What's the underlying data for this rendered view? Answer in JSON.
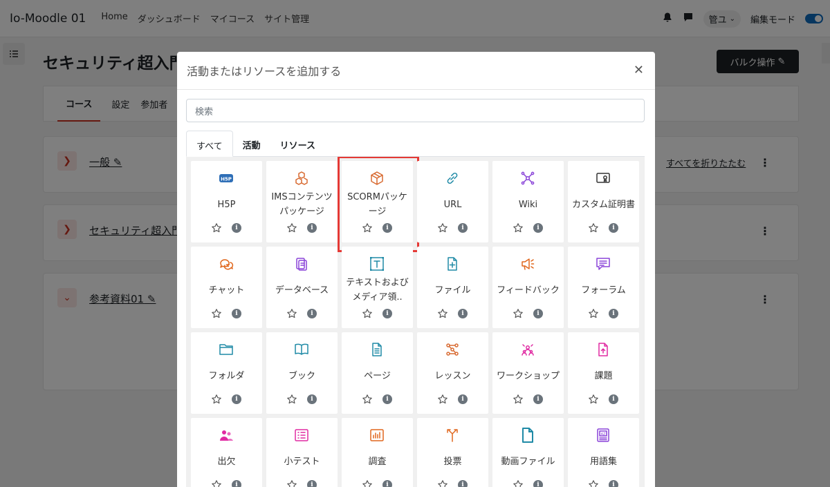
{
  "navbar": {
    "brand": "Io-Moodle 01",
    "links": [
      "Home",
      "ダッシュボード",
      "マイコース",
      "サイト管理"
    ],
    "user": "管ユ",
    "edit_mode_label": "編集モード"
  },
  "course": {
    "title": "セキュリティ超入門",
    "bulk_button": "バルク操作",
    "tabs": [
      "コース",
      "設定",
      "参加者"
    ],
    "collapse_all": "すべてを折りたたむ",
    "sections": [
      "一般",
      "セキュリティ超入門",
      "参考資料01"
    ]
  },
  "modal": {
    "title": "活動またはリソースを追加する",
    "search_placeholder": "検索",
    "tabs": [
      "すべて",
      "活動",
      "リソース"
    ],
    "highlighted": "SCORMパッケージ",
    "items": [
      {
        "name": "H5P",
        "icon": "h5p-icon",
        "color": "#2f6fb7"
      },
      {
        "name": "IMSコンテンツパッケージ",
        "icon": "ims-package-icon",
        "color": "#d86a31"
      },
      {
        "name": "SCORMパッケージ",
        "icon": "scorm-package-icon",
        "color": "#d86a31"
      },
      {
        "name": "URL",
        "icon": "link-icon",
        "color": "#1f8aa6"
      },
      {
        "name": "Wiki",
        "icon": "wiki-icon",
        "color": "#8a44d8"
      },
      {
        "name": "カスタム証明書",
        "icon": "certificate-icon",
        "color": "#333333"
      },
      {
        "name": "チャット",
        "icon": "chat-icon",
        "color": "#e0671d"
      },
      {
        "name": "データベース",
        "icon": "database-icon",
        "color": "#8a44d8"
      },
      {
        "name": "テキストおよびメディア領..",
        "icon": "text-media-icon",
        "color": "#1f8aa6"
      },
      {
        "name": "ファイル",
        "icon": "file-icon",
        "color": "#1f8aa6"
      },
      {
        "name": "フィードバック",
        "icon": "feedback-icon",
        "color": "#e0671d"
      },
      {
        "name": "フォーラム",
        "icon": "forum-icon",
        "color": "#8a44d8"
      },
      {
        "name": "フォルダ",
        "icon": "folder-icon",
        "color": "#1f8aa6"
      },
      {
        "name": "ブック",
        "icon": "book-icon",
        "color": "#1f8aa6"
      },
      {
        "name": "ページ",
        "icon": "page-icon",
        "color": "#1f8aa6"
      },
      {
        "name": "レッスン",
        "icon": "lesson-icon",
        "color": "#d86a31"
      },
      {
        "name": "ワークショップ",
        "icon": "workshop-icon",
        "color": "#e02aa2"
      },
      {
        "name": "課題",
        "icon": "assignment-icon",
        "color": "#e02aa2"
      },
      {
        "name": "出欠",
        "icon": "attendance-icon",
        "color": "#e02aa2"
      },
      {
        "name": "小テスト",
        "icon": "quiz-icon",
        "color": "#e02aa2"
      },
      {
        "name": "調査",
        "icon": "survey-icon",
        "color": "#e0671d"
      },
      {
        "name": "投票",
        "icon": "choice-icon",
        "color": "#e0671d"
      },
      {
        "name": "動画ファイル",
        "icon": "video-file-icon",
        "color": "#1f8aa6"
      },
      {
        "name": "用語集",
        "icon": "glossary-icon",
        "color": "#8a44d8"
      }
    ]
  }
}
